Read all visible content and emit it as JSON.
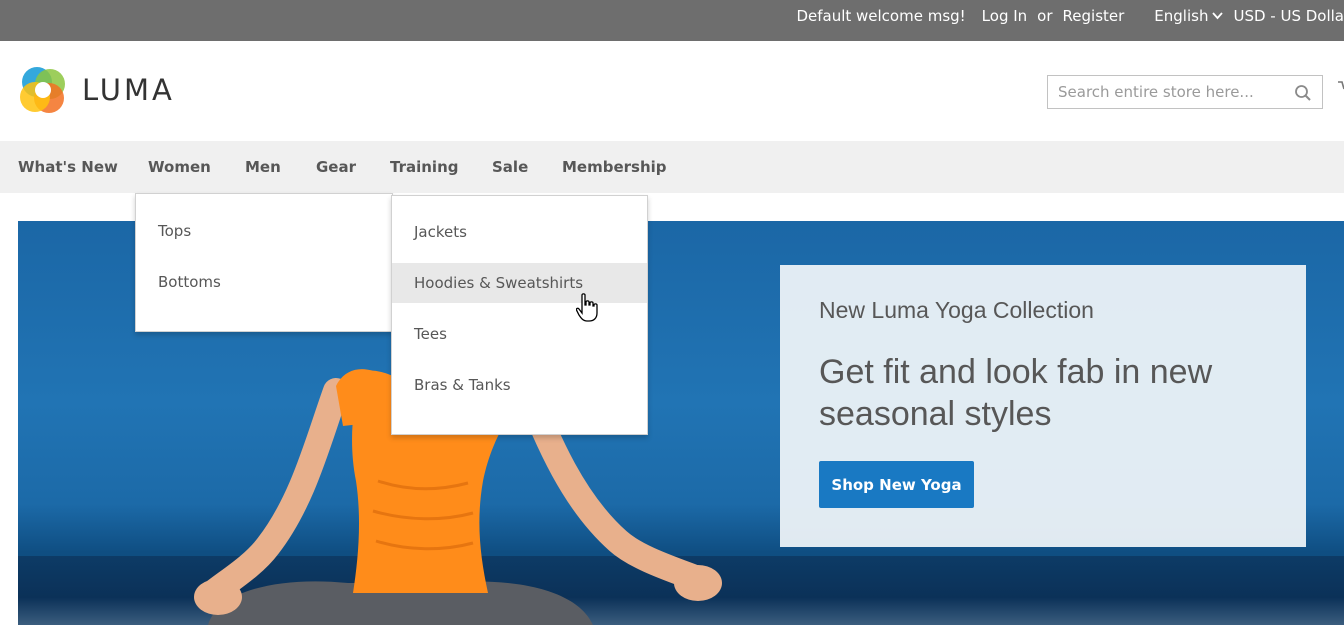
{
  "topbar": {
    "welcome": "Default welcome msg!",
    "login": "Log In",
    "or": "or",
    "register": "Register",
    "language": "English",
    "currency": "USD - US Dolla"
  },
  "header": {
    "logo_text": "LUMA",
    "search_placeholder": "Search entire store here..."
  },
  "nav": {
    "items": [
      "What's New",
      "Women",
      "Men",
      "Gear",
      "Training",
      "Sale",
      "Membership"
    ]
  },
  "women_menu": {
    "categories": [
      "Tops",
      "Bottoms"
    ],
    "tops_subcategories": [
      "Jackets",
      "Hoodies & Sweatshirts",
      "Tees",
      "Bras & Tanks"
    ],
    "hovered": "Hoodies & Sweatshirts"
  },
  "promo": {
    "subtitle": "New Luma Yoga Collection",
    "headline": "Get fit and look fab in new seasonal styles",
    "button_label": "Shop New Yoga"
  },
  "colors": {
    "topbar_bg": "#6e6e6e",
    "nav_bg": "#f0f0f0",
    "accent_blue": "#1979c3",
    "shirt_orange": "#ff8c1a"
  }
}
